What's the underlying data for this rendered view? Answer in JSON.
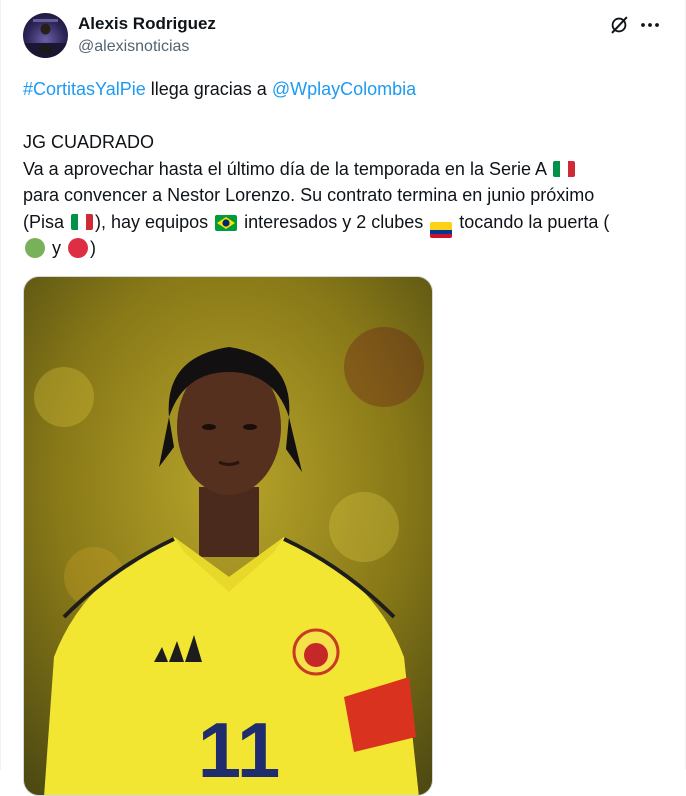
{
  "author": {
    "name": "Alexis Rodriguez",
    "handle": "@alexisnoticias"
  },
  "header_icons": [
    "grok-icon",
    "more-icon"
  ],
  "tweet": {
    "hashtag": "#CortitasYalPie",
    "intro_mid": " llega gracias a ",
    "mention": "@WplayColombia",
    "heading": "JG CUADRADO",
    "l1": "Va a aprovechar hasta el último día de la temporada en la Serie A",
    "l2": "para convencer a Nestor Lorenzo. Su contrato termina en junio próximo",
    "l3a": "(Pisa",
    "l3b": "), hay equipos",
    "l3c": "interesados y 2 clubes",
    "l3d": "tocando la puerta (",
    "l4a": "y",
    "l4b": ")"
  },
  "colors": {
    "link": "#1d9bf0",
    "text": "#0f1419",
    "secondary": "#536471",
    "italy_green": "#009246",
    "italy_white": "#ffffff",
    "italy_red": "#ce2b37",
    "colombia_yellow": "#fcd116",
    "colombia_blue": "#003893",
    "colombia_red": "#ce1126",
    "brazil_green": "#009c3b",
    "brazil_yellow": "#ffdf00",
    "brazil_blue": "#002776",
    "green_circle": "#78b159",
    "red_circle": "#dd2e44"
  },
  "media": {
    "subject": "player-photo",
    "jersey_number": "11"
  }
}
